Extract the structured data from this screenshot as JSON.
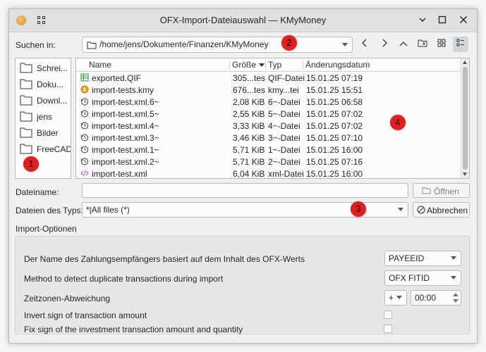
{
  "window": {
    "title": "OFX-Import-Dateiauswahl — KMyMoney",
    "controls": {
      "minimize": "⌵",
      "maximize": "☐",
      "close": "✕"
    }
  },
  "lookin": {
    "label": "Suchen in:",
    "path": "/home/jens/Dokumente/Finanzen/KMyMoney"
  },
  "places": [
    {
      "label": "Schrei..."
    },
    {
      "label": "Doku..."
    },
    {
      "label": "Downl..."
    },
    {
      "label": "jens"
    },
    {
      "label": "Bilder"
    },
    {
      "label": "FreeCAD"
    }
  ],
  "columns": {
    "name": "Name",
    "size": "Größe",
    "type": "Typ",
    "date": "Änderungsdatum"
  },
  "files": [
    {
      "name": "exported.QIF",
      "size": "305...tes",
      "type": "QIF-Datei",
      "date": "15.01.25 07:19",
      "icon": "spreadsheet-icon"
    },
    {
      "name": "import-tests.kmy",
      "size": "676...tes",
      "type": "kmy...tei",
      "date": "15.01.25 15:51",
      "icon": "kmymoney-file-icon"
    },
    {
      "name": "import-test.xml.6~",
      "size": "2,08 KiB",
      "type": "6~-Datei",
      "date": "15.01.25 06:58",
      "icon": "backup-file-icon"
    },
    {
      "name": "import-test.xml.5~",
      "size": "2,55 KiB",
      "type": "5~-Datei",
      "date": "15.01.25 07:02",
      "icon": "backup-file-icon"
    },
    {
      "name": "import-test.xml.4~",
      "size": "3,33 KiB",
      "type": "4~-Datei",
      "date": "15.01.25 07:02",
      "icon": "backup-file-icon"
    },
    {
      "name": "import-test.xml.3~",
      "size": "3,46 KiB",
      "type": "3~-Datei",
      "date": "15.01.25 07:10",
      "icon": "backup-file-icon"
    },
    {
      "name": "import-test.xml.1~",
      "size": "5,71 KiB",
      "type": "1~-Datei",
      "date": "15.01.25 16:00",
      "icon": "backup-file-icon"
    },
    {
      "name": "import-test.xml.2~",
      "size": "5,71 KiB",
      "type": "2~-Datei",
      "date": "15.01.25 07:16",
      "icon": "backup-file-icon"
    },
    {
      "name": "import-test.xml",
      "size": "6,04 KiB",
      "type": "xml-Datei",
      "date": "15.01.25 16:00",
      "icon": "xml-file-icon"
    }
  ],
  "filename": {
    "label": "Dateiname:",
    "value": "",
    "open_button": "Öffnen"
  },
  "filetype": {
    "label": "Dateien des Typs:",
    "value": "*|All files (*)",
    "cancel_button": "Abbrechen"
  },
  "import_options": {
    "heading": "Import-Optionen",
    "payee_label": "Der Name des Zahlungsempfängers basiert auf dem Inhalt des OFX-Werts",
    "payee_value": "PAYEEID",
    "duplicate_label": "Method to detect duplicate transactions during import",
    "duplicate_value": "OFX FITID",
    "timezone_label": "Zeitzonen-Abweichung",
    "timezone_sign": "+",
    "timezone_value": "00:00",
    "invert_label": "Invert sign of transaction amount",
    "fix_label": "Fix sign of the investment transaction amount and quantity"
  },
  "markers": [
    "1",
    "2",
    "3",
    "4"
  ]
}
